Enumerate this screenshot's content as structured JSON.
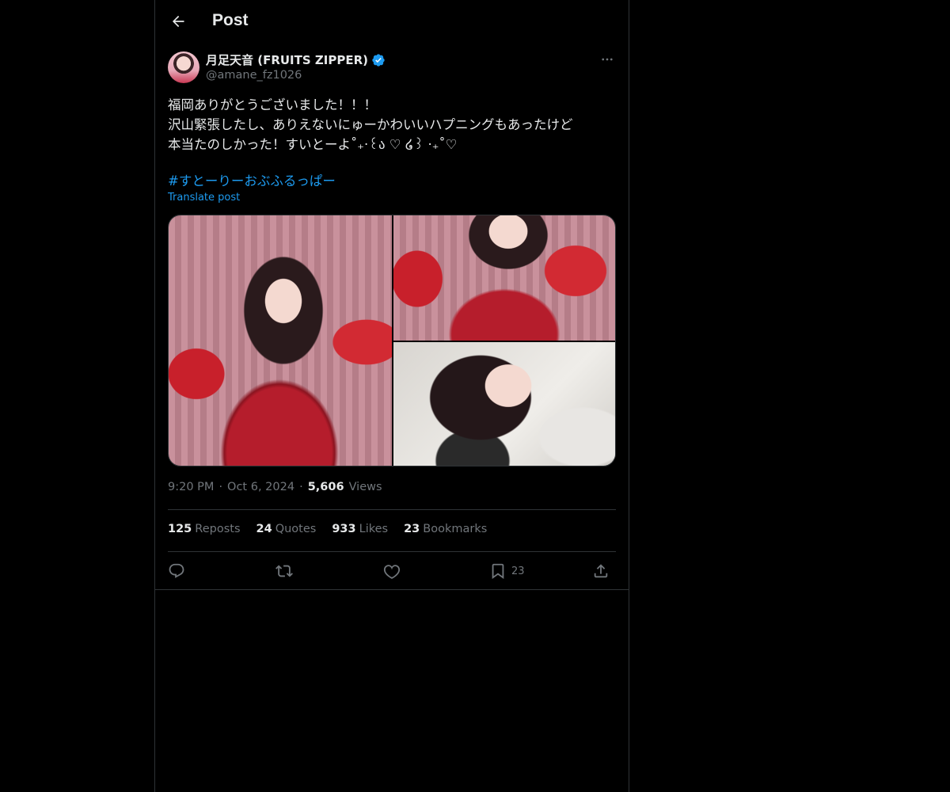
{
  "header": {
    "title": "Post",
    "back_icon": "arrow-left-icon"
  },
  "author": {
    "display_name": "月足天音 (FRUITS ZIPPER)",
    "handle": "@amane_fz1026",
    "verified_icon": "verified-badge-icon",
    "verified_color": "#1d9bf0"
  },
  "post": {
    "text": "福岡ありがとうございました！！！\n沢山緊張したし、ありえないにゅーかわいいハプニングもあったけど\n本当たのしかった！すいとーよ˚₊‧꒰ა ♡ ໒꒱ ‧₊˚♡",
    "hashtag": "#すとーりーおぶふるっぱー",
    "translate_label": "Translate post",
    "images": [
      "photo-1",
      "photo-2",
      "photo-3"
    ]
  },
  "meta": {
    "time": "9:20 PM",
    "separator": "·",
    "date": "Oct 6, 2024",
    "views_count": "5,606",
    "views_label": "Views"
  },
  "stats": {
    "reposts_count": "125",
    "reposts_label": "Reposts",
    "quotes_count": "24",
    "quotes_label": "Quotes",
    "likes_count": "933",
    "likes_label": "Likes",
    "bookmarks_count": "23",
    "bookmarks_label": "Bookmarks"
  },
  "actions": {
    "reply_icon": "reply-icon",
    "repost_icon": "repost-icon",
    "like_icon": "heart-icon",
    "bookmark_icon": "bookmark-icon",
    "bookmark_count": "23",
    "share_icon": "share-icon"
  },
  "colors": {
    "background": "#000000",
    "text": "#e7e9ea",
    "muted": "#71767b",
    "link": "#1d9bf0",
    "border": "#2f3336"
  }
}
